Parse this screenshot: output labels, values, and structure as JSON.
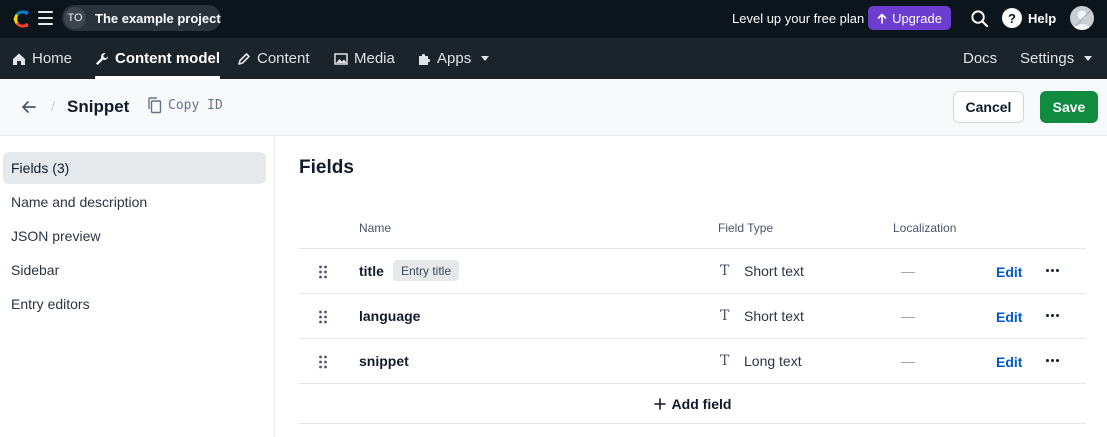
{
  "topbar": {
    "project_initials": "TO",
    "project_name": "The example project",
    "level_up_text": "Level up your free plan",
    "upgrade_label": "Upgrade",
    "help_label": "Help"
  },
  "nav": {
    "items": [
      {
        "label": "Home",
        "icon": "home-icon"
      },
      {
        "label": "Content model",
        "icon": "wrench-icon",
        "active": true
      },
      {
        "label": "Content",
        "icon": "pen-icon"
      },
      {
        "label": "Media",
        "icon": "image-icon"
      },
      {
        "label": "Apps",
        "icon": "puzzle-icon",
        "dropdown": true
      }
    ],
    "docs_label": "Docs",
    "settings_label": "Settings"
  },
  "header": {
    "title": "Snippet",
    "copy_id_label": "Copy ID",
    "cancel_label": "Cancel",
    "save_label": "Save"
  },
  "sidebar": {
    "items": [
      {
        "label": "Fields (3)",
        "active": true
      },
      {
        "label": "Name and description"
      },
      {
        "label": "JSON preview"
      },
      {
        "label": "Sidebar"
      },
      {
        "label": "Entry editors"
      }
    ]
  },
  "main": {
    "heading": "Fields",
    "columns": {
      "name": "Name",
      "field_type": "Field Type",
      "localization": "Localization"
    },
    "rows": [
      {
        "name": "title",
        "badge": "Entry title",
        "type": "Short text",
        "localization": "—",
        "edit": "Edit"
      },
      {
        "name": "language",
        "type": "Short text",
        "localization": "—",
        "edit": "Edit"
      },
      {
        "name": "snippet",
        "type": "Long text",
        "localization": "—",
        "edit": "Edit"
      }
    ],
    "add_field_label": "Add field"
  },
  "colors": {
    "topbar_bg": "#0c141c",
    "nav_bg": "#1b232b",
    "upgrade": "#6c3ecf",
    "save": "#108b3f",
    "link": "#0059c8"
  }
}
